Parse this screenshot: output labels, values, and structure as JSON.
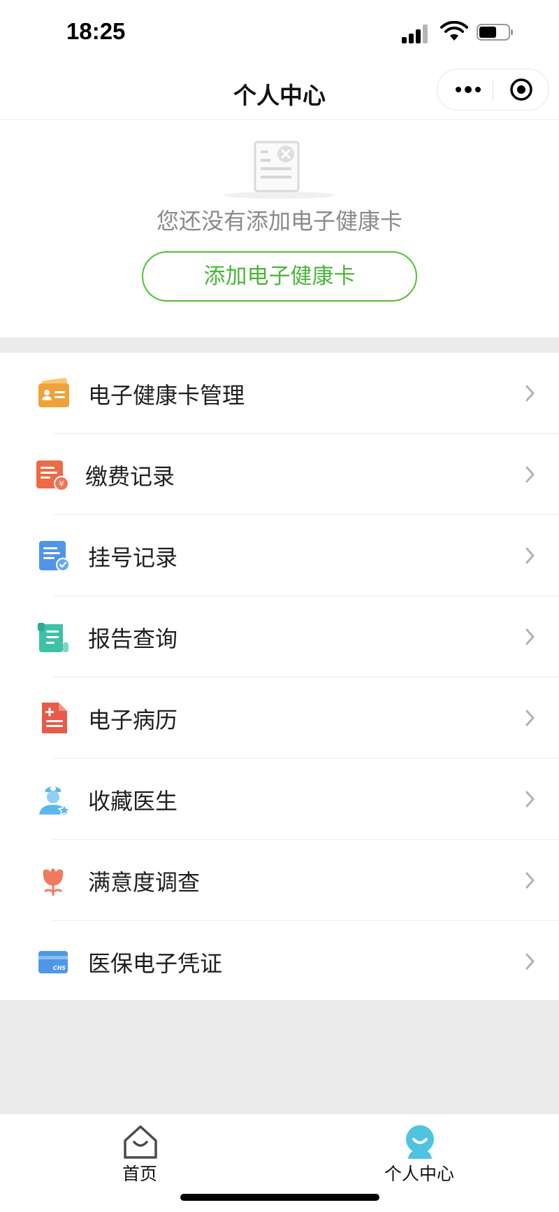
{
  "status": {
    "time": "18:25"
  },
  "nav": {
    "title": "个人中心",
    "more_icon": "more-dots-icon",
    "close_icon": "target-close-icon"
  },
  "empty": {
    "message": "您还没有添加电子健康卡",
    "add_button": "添加电子健康卡",
    "illustration": "empty-card-icon"
  },
  "menu": {
    "items": [
      {
        "label": "电子健康卡管理",
        "icon": "health-card-icon",
        "color": "#f0a23a"
      },
      {
        "label": "缴费记录",
        "icon": "payment-record-icon",
        "color": "#ec6a45"
      },
      {
        "label": "挂号记录",
        "icon": "registration-record-icon",
        "color": "#4f95e8"
      },
      {
        "label": "报告查询",
        "icon": "report-query-icon",
        "color": "#3fc1a6"
      },
      {
        "label": "电子病历",
        "icon": "medical-record-icon",
        "color": "#e85a4a"
      },
      {
        "label": "收藏医生",
        "icon": "favorite-doctor-icon",
        "color": "#5cb8ec"
      },
      {
        "label": "满意度调查",
        "icon": "satisfaction-survey-icon",
        "color": "#f07a5e"
      },
      {
        "label": "医保电子凭证",
        "icon": "medical-insurance-icon",
        "color": "#4d97ea",
        "icon_text": "CHS"
      }
    ]
  },
  "tabbar": {
    "tabs": [
      {
        "label": "首页",
        "icon": "home-icon",
        "active": false
      },
      {
        "label": "个人中心",
        "icon": "profile-icon",
        "active": true,
        "color": "#4fc3e0"
      }
    ]
  }
}
